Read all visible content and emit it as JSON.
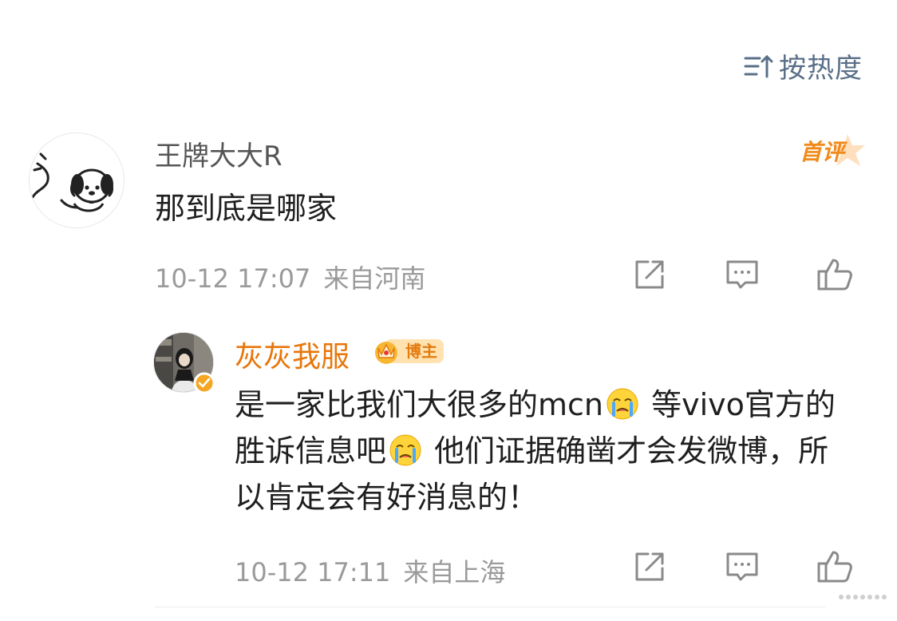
{
  "sort": {
    "label": "按热度",
    "icon": "sort-icon"
  },
  "comment": {
    "username": "王牌大大R",
    "badge": "首评",
    "text": "那到底是哪家",
    "time": "10-12 17:07",
    "location": "来自河南",
    "avatar": "dog-doodle-avatar"
  },
  "reply": {
    "username": "灰灰我服",
    "badge": "博主",
    "text_parts": [
      "是一家比我们大很多的mcn",
      " 等vivo官方的胜诉信息吧",
      " 他们证据确凿才会发微博，所以肯定会有好消息的！"
    ],
    "emoji": "crying-face-emoji",
    "time": "10-12 17:11",
    "location": "来自上海",
    "avatar": "user-photo-avatar"
  },
  "colors": {
    "username_blogger": "#e8760b",
    "meta": "#9a9a9a",
    "sort": "#5a6f88",
    "badge_first": "#f08a1a"
  }
}
